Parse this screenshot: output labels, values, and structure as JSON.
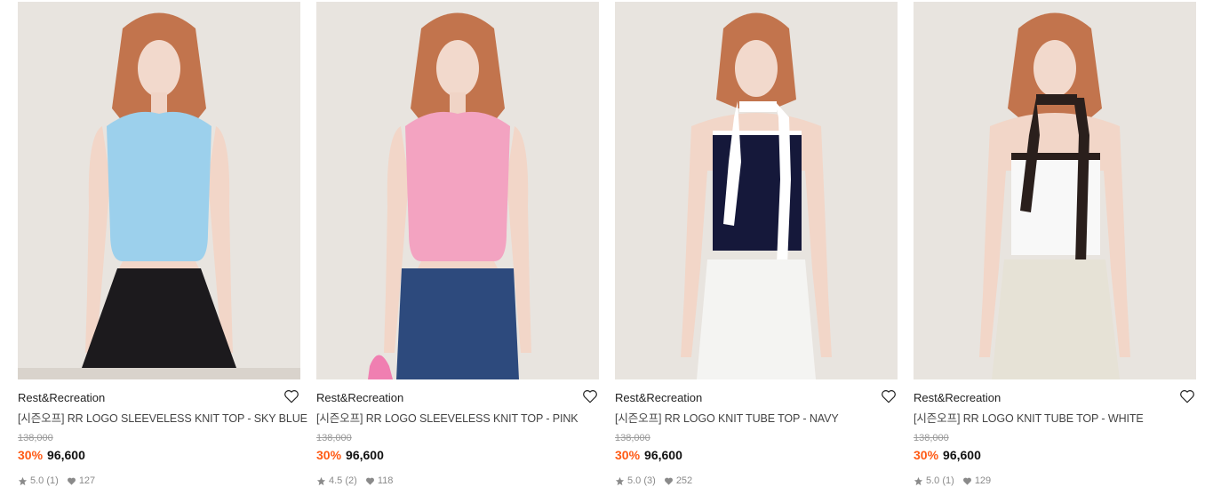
{
  "products": [
    {
      "brand": "Rest&Recreation",
      "name": "[시즌오프] RR LOGO SLEEVELESS KNIT TOP - SKY BLUE",
      "original_price": "138,000",
      "discount": "30%",
      "sale_price": "96,600",
      "rating": "5.0",
      "reviews": "(1)",
      "likes": "127",
      "top_color": "#9cd0ec",
      "bottom_color": "#1c1a1d"
    },
    {
      "brand": "Rest&Recreation",
      "name": "[시즌오프] RR LOGO SLEEVELESS KNIT TOP - PINK",
      "original_price": "138,000",
      "discount": "30%",
      "sale_price": "96,600",
      "rating": "4.5",
      "reviews": "(2)",
      "likes": "118",
      "top_color": "#f3a3c1",
      "bottom_color": "#2d4a7d"
    },
    {
      "brand": "Rest&Recreation",
      "name": "[시즌오프] RR LOGO KNIT TUBE TOP - NAVY",
      "original_price": "138,000",
      "discount": "30%",
      "sale_price": "96,600",
      "rating": "5.0",
      "reviews": "(3)",
      "likes": "252",
      "top_color": "#15183a",
      "bottom_color": "#f4f4f2"
    },
    {
      "brand": "Rest&Recreation",
      "name": "[시즌오프] RR LOGO KNIT TUBE TOP - WHITE",
      "original_price": "138,000",
      "discount": "30%",
      "sale_price": "96,600",
      "rating": "5.0",
      "reviews": "(1)",
      "likes": "129",
      "top_color": "#f8f8f8",
      "bottom_color": "#e6e2d6"
    }
  ],
  "colors": {
    "discount": "#ff5a14",
    "muted": "#8a8a8a"
  },
  "icons": {
    "like": "heart-outline-icon",
    "rating": "star-icon",
    "like_count": "heart-filled-icon"
  }
}
